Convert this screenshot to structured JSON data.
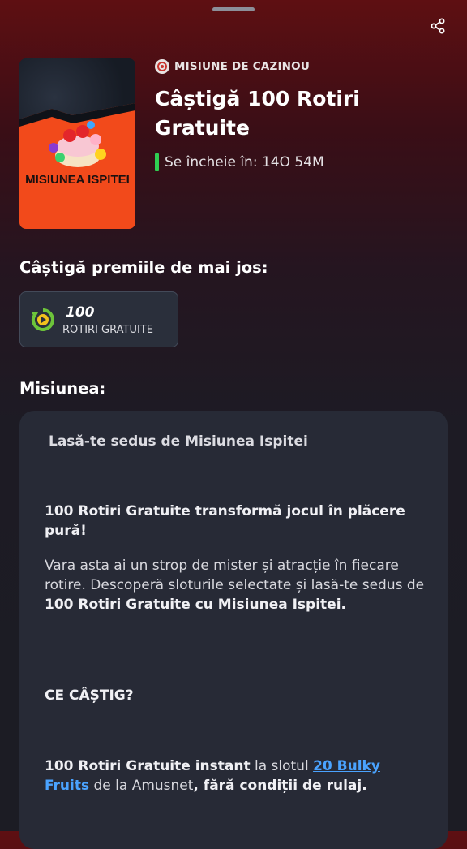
{
  "header": {
    "badge": "MISIUNE DE CAZINOU",
    "title": "Câștigă 100 Rotiri Gratuite",
    "ends_label": "Se încheie în: 14O 54M"
  },
  "thumbnail": {
    "text": "MISIUNEA ISPITEI"
  },
  "prizes_heading": "Câștigă premiile de mai jos:",
  "prize": {
    "amount": "100",
    "label": "ROTIRI GRATUITE"
  },
  "mission_heading": "Misiunea:",
  "mission": {
    "subtitle": "Lasă-te sedus de Misiunea Ispitei",
    "p1": "100 Rotiri Gratuite transformă jocul în plăcere pură!",
    "p2_a": "Vara asta ai un strop de mister și atracție în fiecare rotire. Descoperă sloturile selectate și lasă-te sedus de ",
    "p2_b": "100 Rotiri Gratuite cu Misiunea Ispitei.",
    "q": "CE CÂȘTIG?",
    "p3_a": "100 Rotiri Gratuite instant",
    "p3_b": " la slotul ",
    "p3_link": "20 Bulky Fruits",
    "p3_c": " de la Amusnet",
    "p3_d": ", fără condiții de rulaj."
  },
  "colors": {
    "accent_green": "#2fcf52",
    "link": "#4aa3ff",
    "card_bg": "#272a36"
  }
}
